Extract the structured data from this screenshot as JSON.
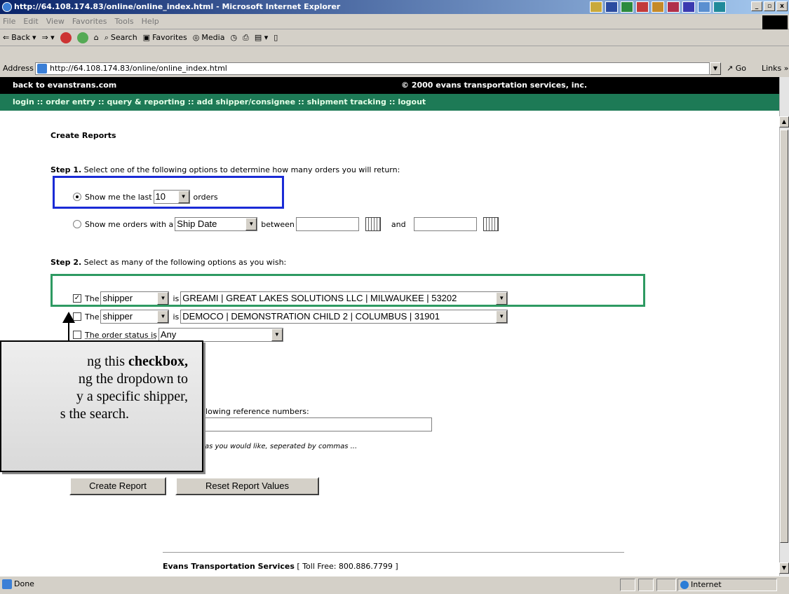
{
  "window": {
    "title": "http://64.108.174.83/online/online_index.html - Microsoft Internet Explorer",
    "controls": [
      "_",
      "▫",
      "x"
    ]
  },
  "menubar": {
    "items": [
      "File",
      "Edit",
      "View",
      "Favorites",
      "Tools",
      "Help"
    ]
  },
  "toolbar": {
    "back": "Back",
    "search": "Search",
    "favorites": "Favorites",
    "media": "Media"
  },
  "addressbar": {
    "label": "Address",
    "url": "http://64.108.174.83/online/online_index.html",
    "go": "Go",
    "links": "Links »"
  },
  "site": {
    "back_link": "back to evanstrans.com",
    "copyright": "© 2000 evans transportation services, inc.",
    "nav": [
      "login",
      "order entry",
      "query & reporting",
      "add shipper/consignee",
      "shipment tracking",
      "logout"
    ],
    "nav_sep": " :: "
  },
  "main": {
    "heading": "Create Reports",
    "step1_label": "Step 1.",
    "step1_text": " Select one of the following options to determine how many orders you will return:",
    "opt1_prefix": "Show me the last",
    "opt1_count": "10",
    "opt1_suffix": "orders",
    "opt2_prefix": "Show me orders with a",
    "opt2_field": "Ship Date",
    "opt2_between": "between",
    "opt2_and": "and",
    "step2_label": "Step 2.",
    "step2_text": " Select as many of the following options as you wish:",
    "filter_the": "The",
    "filter_is": "is",
    "filter1_field": "shipper",
    "filter1_value": "GREAMI | GREAT LAKES SOLUTIONS LLC | MILWAUKEE | 53202",
    "filter2_field": "shipper",
    "filter2_value": "DEMOCO | DEMONSTRATION CHILD 2 | COLUMBUS | 31901",
    "status_label": "The order status is",
    "status_value": "Any",
    "ref_label": "llowing reference numbers:",
    "ref_hint": "as you would like, seperated by commas ...",
    "create_button": "Create Report",
    "reset_button": "Reset Report Values",
    "footer_name": "Evans Transportation Services",
    "footer_phone": "[ Toll Free: 800.886.7799 ]"
  },
  "callout": {
    "line1a": "ng this ",
    "line1b": "checkbox,",
    "line2": "ng the dropdown to",
    "line3": "y a specific shipper,",
    "line4": "s the search."
  },
  "status": {
    "left": "Done",
    "zone": "Internet"
  }
}
